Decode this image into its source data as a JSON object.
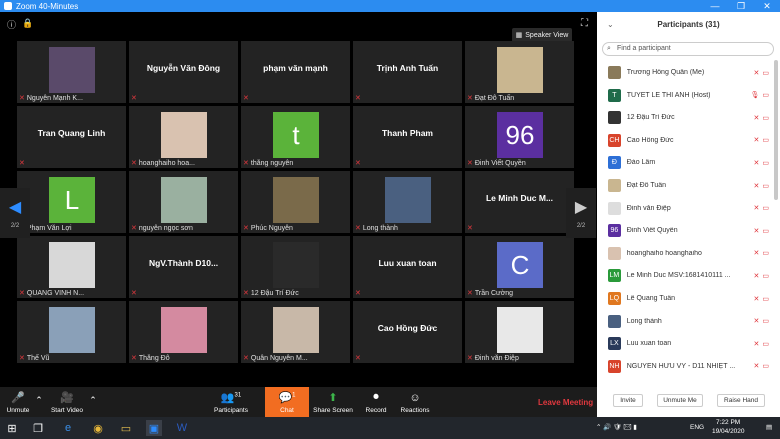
{
  "window": {
    "title": "Zoom 40-Minutes"
  },
  "view": {
    "speaker_label": "Speaker View"
  },
  "tiles": [
    {
      "name": "Nguyễn Mạnh K...",
      "display": "",
      "has_photo": true,
      "photo": "#5a4a6a"
    },
    {
      "name": "",
      "display": "Nguyễn Văn Đông"
    },
    {
      "name": "",
      "display": "phạm văn mạnh"
    },
    {
      "name": "",
      "display": "Trịnh Anh Tuấn"
    },
    {
      "name": "Đạt Đỗ Tuấn",
      "display": "",
      "has_photo": true,
      "photo": "#c9b690"
    },
    {
      "name": "",
      "display": "Tran Quang Linh"
    },
    {
      "name": "hoanghaiho hoa...",
      "display": "",
      "has_photo": true,
      "photo": "#d9c2b0"
    },
    {
      "name": "thắng nguyễn",
      "display": "",
      "avatar": "t",
      "avatar_color": "#5bb33a"
    },
    {
      "name": "",
      "display": "Thanh Pham"
    },
    {
      "name": "Đinh Viết Quyền",
      "display": "",
      "avatar": "96",
      "avatar_color": "#5b2fa0"
    },
    {
      "name": "Phạm Văn Lợi",
      "display": "",
      "avatar": "L",
      "avatar_color": "#5bb33a"
    },
    {
      "name": "nguyễn ngọc sơn",
      "display": "",
      "has_photo": true,
      "photo": "#9ab0a0"
    },
    {
      "name": "Phúc Nguyễn",
      "display": "",
      "has_photo": true,
      "photo": "#7a6a4a"
    },
    {
      "name": "Long thành",
      "display": "",
      "has_photo": true,
      "photo": "#4a6080"
    },
    {
      "name": "",
      "display": "Le Minh Duc   M..."
    },
    {
      "name": "QUANG VINH N...",
      "display": "",
      "has_photo": true,
      "photo": "#d8d8d8"
    },
    {
      "name": "",
      "display": "NgV.Thành  D10..."
    },
    {
      "name": "12 Đậu Trí Đức",
      "display": "",
      "has_photo": true,
      "photo": "#2a2a2a"
    },
    {
      "name": "",
      "display": "Luu xuan toan"
    },
    {
      "name": "Trần Cường",
      "display": "",
      "avatar": "C",
      "avatar_color": "#5b6bc8"
    },
    {
      "name": "Thế Vũ",
      "display": "",
      "has_photo": true,
      "photo": "#8aa0b8"
    },
    {
      "name": "Thắng Đỗ",
      "display": "",
      "has_photo": true,
      "photo": "#d48aa0"
    },
    {
      "name": "Quân Nguyễn M...",
      "display": "",
      "has_photo": true,
      "photo": "#c8b8a8"
    },
    {
      "name": "",
      "display": "Cao Hồng Đức"
    },
    {
      "name": "Đinh văn Điệp",
      "display": "",
      "has_photo": true,
      "photo": "#e8e8e8"
    }
  ],
  "nav": {
    "left_page": "2/2",
    "right_page": "2/2"
  },
  "toolbar": {
    "unmute": "Unmute",
    "start_video": "Start Video",
    "participants": "Participants",
    "participants_count": "31",
    "chat": "Chat",
    "chat_badge": "1",
    "share": "Share Screen",
    "record": "Record",
    "reactions": "Reactions",
    "leave": "Leave Meeting"
  },
  "panel": {
    "title": "Participants (31)",
    "search_placeholder": "Find a participant",
    "items": [
      {
        "name": "Trương Hồng Quân (Me)",
        "avatar": "",
        "color": "#8a7a5a",
        "status": "✕▭"
      },
      {
        "name": "TUYET LE THI ANH (Host)",
        "avatar": "T",
        "color": "#1f6b4a",
        "status": "🎙▭"
      },
      {
        "name": "12 Đậu Trí Đức",
        "avatar": "",
        "color": "#333",
        "status": "✕▭"
      },
      {
        "name": "Cao Hồng Đức",
        "avatar": "CH",
        "color": "#d8442c",
        "status": "✕▭"
      },
      {
        "name": "Đào Lâm",
        "avatar": "Đ",
        "color": "#2d6fd6",
        "status": "✕▭"
      },
      {
        "name": "Đạt Đỗ Tuấn",
        "avatar": "",
        "color": "#c9b690",
        "status": "✕▭"
      },
      {
        "name": "Đinh văn Điệp",
        "avatar": "",
        "color": "#ddd",
        "status": "✕▭"
      },
      {
        "name": "Đinh Viết Quyền",
        "avatar": "96",
        "color": "#5b2fa0",
        "status": "✕▭"
      },
      {
        "name": "hoanghaiho hoanghaiho",
        "avatar": "",
        "color": "#d9c2b0",
        "status": "✕▭"
      },
      {
        "name": "Le Minh Duc   MSV:1681410111 ...",
        "avatar": "LM",
        "color": "#2a9a3a",
        "status": "✕▭"
      },
      {
        "name": "Lê Quang Tuấn",
        "avatar": "LQ",
        "color": "#e07820",
        "status": "✕▭"
      },
      {
        "name": "Long thành",
        "avatar": "",
        "color": "#4a6080",
        "status": "✕▭"
      },
      {
        "name": "Luu xuan toan",
        "avatar": "LX",
        "color": "#2a3a5a",
        "status": "✕▭"
      },
      {
        "name": "NGUYỄN HỮU VỸ - D11 NHIỆT ...",
        "avatar": "NH",
        "color": "#d8442c",
        "status": "✕▭"
      }
    ],
    "invite": "Invite",
    "mute_me": "Unmute Me",
    "raise_hand": "Raise Hand"
  },
  "taskbar": {
    "lang": "ENG",
    "time": "7:22 PM",
    "date": "19/04/2020"
  }
}
